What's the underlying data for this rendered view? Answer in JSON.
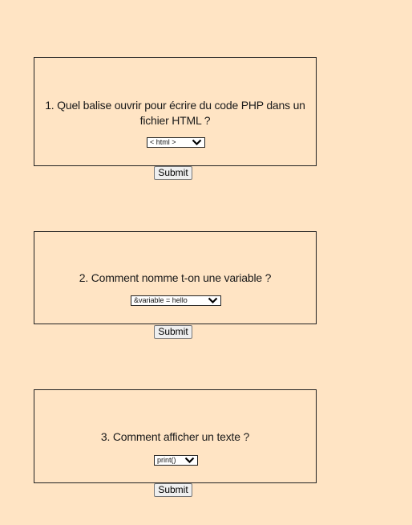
{
  "questions": [
    {
      "text": "1. Quel balise ouvrir pour écrire du code PHP dans un fichier HTML ?",
      "selected": "< html >",
      "submit_label": "Submit"
    },
    {
      "text": "2. Comment nomme t-on une variable ?",
      "selected": "&variable = hello",
      "submit_label": "Submit"
    },
    {
      "text": "3. Comment afficher un texte ?",
      "selected": "print()",
      "submit_label": "Submit"
    }
  ],
  "colors": {
    "background": "#ffe4c4",
    "border": "#222222"
  },
  "icons": {
    "dropdown": "chevron-down-icon"
  }
}
